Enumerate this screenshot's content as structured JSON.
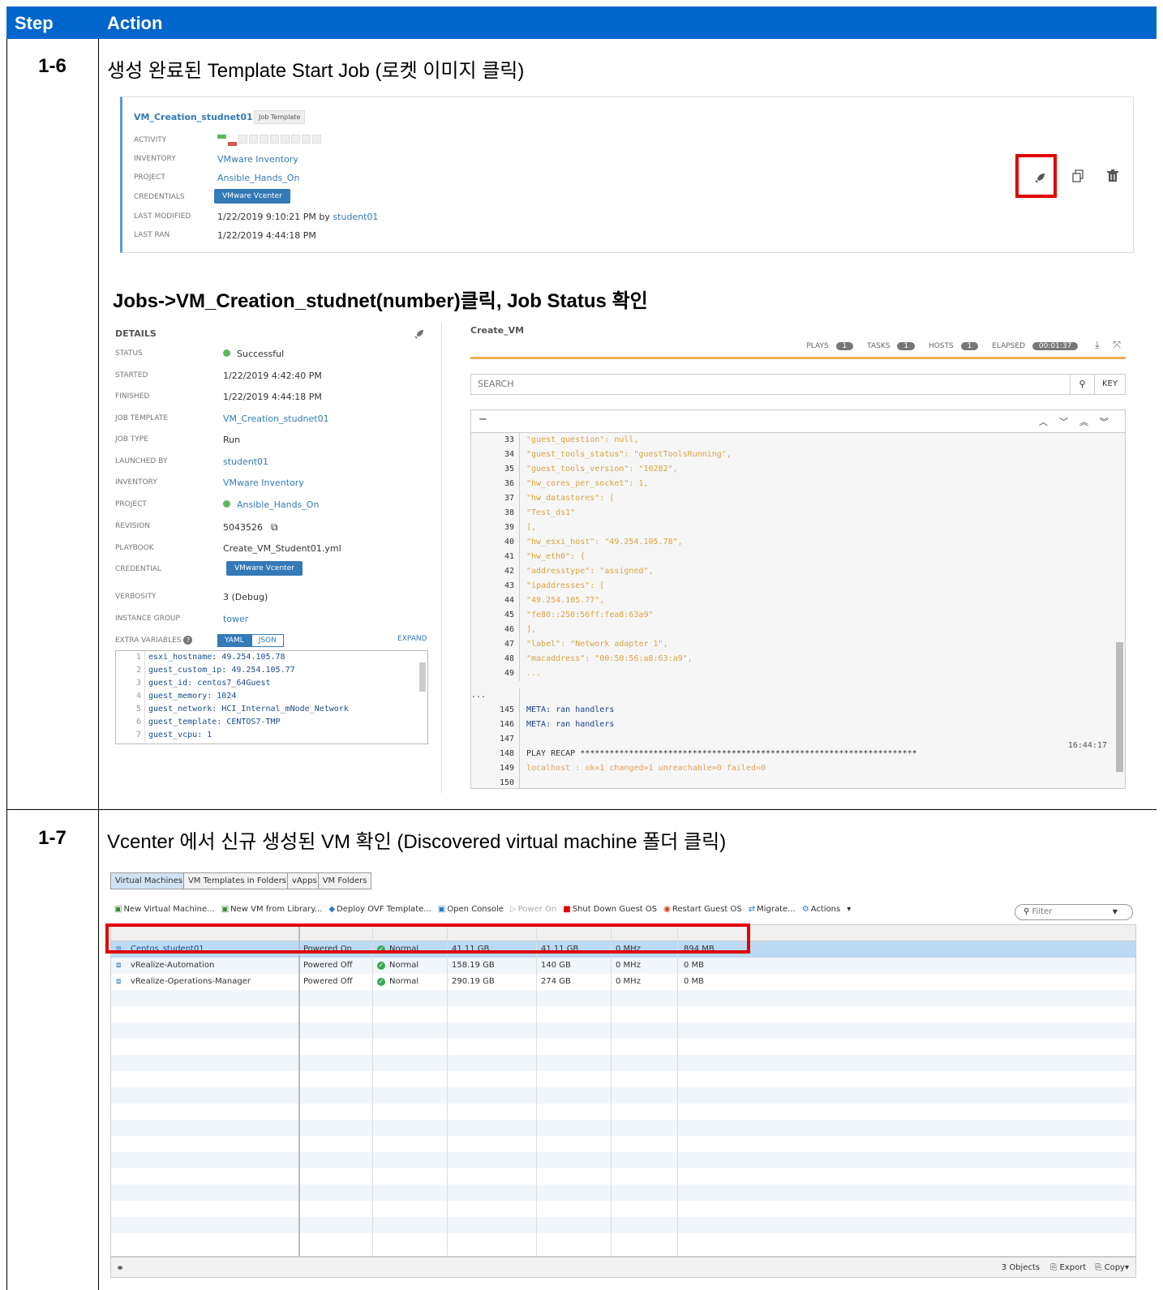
{
  "table": {
    "header_step": "Step",
    "header_action": "Action"
  },
  "step16": {
    "label": "1-6",
    "heading": "생성 완료된 Template Start Job (로켓 이미지 클릭)",
    "subheading": "Jobs->VM_Creation_studnet(number)클릭, Job Status 확인"
  },
  "template_card": {
    "title": "VM_Creation_studnet01",
    "badge": "Job Template",
    "activity_label": "ACTIVITY",
    "inventory_label": "INVENTORY",
    "inventory": "VMware Inventory",
    "project_label": "PROJECT",
    "project": "Ansible_Hands_On",
    "credentials_label": "CREDENTIALS",
    "credentials": "VMware Vcenter",
    "last_modified_label": "LAST MODIFIED",
    "last_modified": "1/22/2019 9:10:21 PM by",
    "last_modified_user": "student01",
    "last_ran_label": "LAST RAN",
    "last_ran": "1/22/2019 4:44:18 PM"
  },
  "details": {
    "title": "DETAILS",
    "rows": [
      {
        "label": "STATUS",
        "value": "Successful"
      },
      {
        "label": "STARTED",
        "value": "1/22/2019 4:42:40 PM"
      },
      {
        "label": "FINISHED",
        "value": "1/22/2019 4:44:18 PM"
      },
      {
        "label": "JOB TEMPLATE",
        "value": "VM_Creation_studnet01"
      },
      {
        "label": "JOB TYPE",
        "value": "Run"
      },
      {
        "label": "LAUNCHED BY",
        "value": "student01"
      },
      {
        "label": "INVENTORY",
        "value": "VMware Inventory"
      },
      {
        "label": "PROJECT",
        "value": "Ansible_Hands_On"
      },
      {
        "label": "REVISION",
        "value": "5043526"
      },
      {
        "label": "PLAYBOOK",
        "value": "Create_VM_Student01.yml"
      },
      {
        "label": "CREDENTIAL",
        "value": "VMware Vcenter"
      },
      {
        "label": "VERBOSITY",
        "value": "3 (Debug)"
      },
      {
        "label": "INSTANCE GROUP",
        "value": "tower"
      },
      {
        "label": "EXTRA VARIABLES",
        "value": ""
      }
    ],
    "yaml_tab": "YAML",
    "json_tab": "JSON",
    "expand": "EXPAND",
    "yaml_lines": [
      {
        "n": "1",
        "t": "esxi_hostname: 49.254.105.78"
      },
      {
        "n": "2",
        "t": "guest_custom_ip: 49.254.105.77"
      },
      {
        "n": "3",
        "t": "guest_id: centos7_64Guest"
      },
      {
        "n": "4",
        "t": "guest_memory: 1024"
      },
      {
        "n": "5",
        "t": "guest_network: HCI_Internal_mNode_Network"
      },
      {
        "n": "6",
        "t": "guest_template: CENTOS7-TMP"
      },
      {
        "n": "7",
        "t": "guest_vcpu: 1"
      }
    ]
  },
  "output": {
    "title": "Create_VM",
    "plays_label": "PLAYS",
    "plays": "1",
    "tasks_label": "TASKS",
    "tasks": "1",
    "hosts_label": "HOSTS",
    "hosts": "1",
    "elapsed_label": "ELAPSED",
    "elapsed": "00:01:37",
    "search_placeholder": "SEARCH",
    "key_label": "KEY",
    "collapse": "−",
    "timestamp": "16:44:17",
    "lines": [
      {
        "n": "33",
        "t": "        \"guest_question\": null,"
      },
      {
        "n": "34",
        "t": "        \"guest_tools_status\": \"guestToolsRunning\","
      },
      {
        "n": "35",
        "t": "        \"guest_tools_version\": \"10282\","
      },
      {
        "n": "36",
        "t": "        \"hw_cores_per_socket\": 1,"
      },
      {
        "n": "37",
        "t": "        \"hw_datastores\": ["
      },
      {
        "n": "38",
        "t": "            \"Test_ds1\""
      },
      {
        "n": "39",
        "t": "        ],"
      },
      {
        "n": "40",
        "t": "        \"hw_esxi_host\": \"49.254.105.78\","
      },
      {
        "n": "41",
        "t": "        \"hw_eth0\": {"
      },
      {
        "n": "42",
        "t": "            \"addresstype\": \"assigned\","
      },
      {
        "n": "43",
        "t": "            \"ipaddresses\": ["
      },
      {
        "n": "44",
        "t": "                \"49.254.105.77\","
      },
      {
        "n": "45",
        "t": "                \"fe80::250:56ff:fea8:63a9\""
      },
      {
        "n": "46",
        "t": "            ],"
      },
      {
        "n": "47",
        "t": "            \"label\": \"Network adapter 1\","
      },
      {
        "n": "48",
        "t": "            \"macaddress\": \"00:50:56:a8:63:a9\","
      },
      {
        "n": "49",
        "t": " ..."
      },
      {
        "n": "...",
        "t": ""
      },
      {
        "n": "145",
        "t": "META: ran handlers"
      },
      {
        "n": "146",
        "t": "META: ran handlers"
      },
      {
        "n": "147",
        "t": ""
      },
      {
        "n": "148",
        "t": "PLAY RECAP *********************************************************************"
      },
      {
        "n": "149",
        "t": "localhost                  : ok=1    changed=1    unreachable=0    failed=0"
      },
      {
        "n": "150",
        "t": ""
      }
    ]
  },
  "step17": {
    "label": "1-7",
    "heading": "Vcenter 에서 신규 생성된 VM 확인 (Discovered virtual machine 폴더 클릭)"
  },
  "vcenter": {
    "tabs": [
      "Virtual Machines",
      "VM Templates in Folders",
      "vApps",
      "VM Folders"
    ],
    "toolbar": [
      "New Virtual Machine...",
      "New VM from Library...",
      "Deploy OVF Template...",
      "Open Console",
      "Power On",
      "Shut Down Guest OS",
      "Restart Guest OS",
      "Migrate...",
      "Actions"
    ],
    "filter_placeholder": "Filter",
    "rows": [
      {
        "name": "Centos_student01",
        "state": "Powered On",
        "status": "Normal",
        "prov": "41.11  GB",
        "used": "41.11  GB",
        "cpu": "0 MHz",
        "mem": "894 MB"
      },
      {
        "name": "vRealize-Automation",
        "state": "Powered Off",
        "status": "Normal",
        "prov": "158.19  GB",
        "used": "140  GB",
        "cpu": "0 MHz",
        "mem": "0 MB"
      },
      {
        "name": "vRealize-Operations-Manager",
        "state": "Powered Off",
        "status": "Normal",
        "prov": "290.19  GB",
        "used": "274  GB",
        "cpu": "0 MHz",
        "mem": "0 MB"
      }
    ],
    "objects": "3 Objects",
    "export": "Export",
    "copy": "Copy"
  }
}
